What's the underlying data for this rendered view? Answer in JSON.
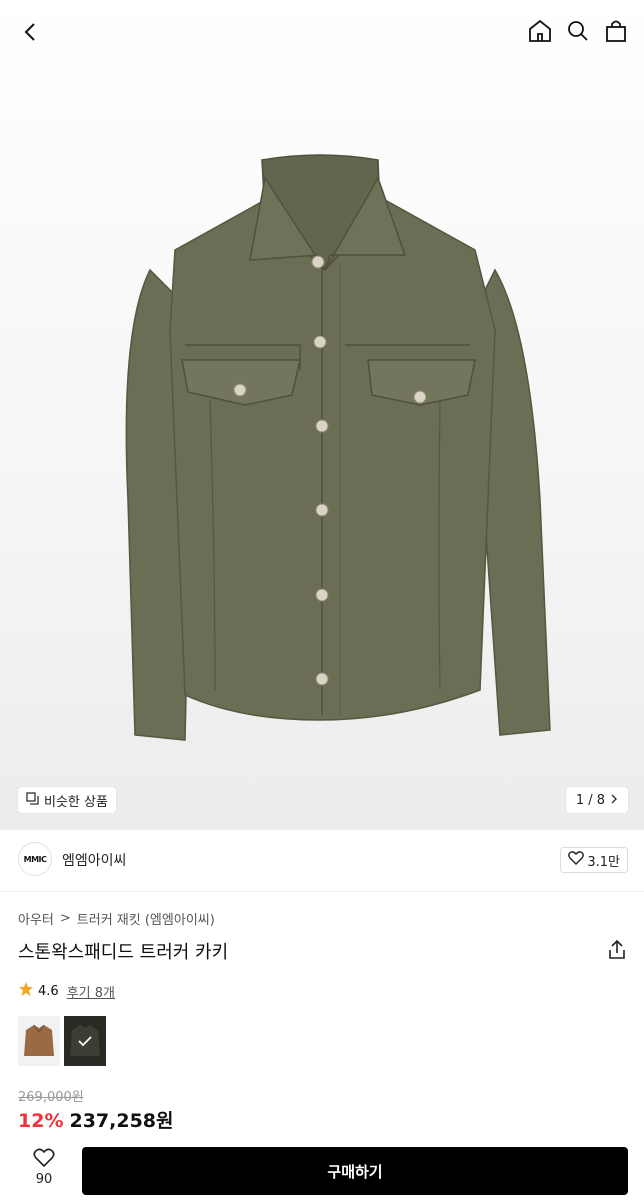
{
  "gallery": {
    "similar_label": "비슷한 상품",
    "counter": "1 / 8"
  },
  "brand": {
    "logo_text": "MMIC",
    "name": "엠엠아이씨",
    "likes": "3.1만"
  },
  "breadcrumb": {
    "level1": "아우터",
    "separator": ">",
    "level2": "트러커 재킷 (엠엠아이씨)"
  },
  "product": {
    "title": "스톤왁스패디드 트러커 카키",
    "rating": "4.6",
    "review_label": "후기 8개",
    "original_price": "269,000원",
    "discount": "12%",
    "price": "237,258원"
  },
  "swatches": [
    {
      "color": "brown",
      "hex": "#9a6a44"
    },
    {
      "color": "khaki",
      "hex": "#3e4238"
    }
  ],
  "bottom_bar": {
    "wish_count": "90",
    "buy_label": "구매하기"
  },
  "colors": {
    "discount": "#f0323c",
    "buy_button": "#000000",
    "star": "#f5a623"
  }
}
